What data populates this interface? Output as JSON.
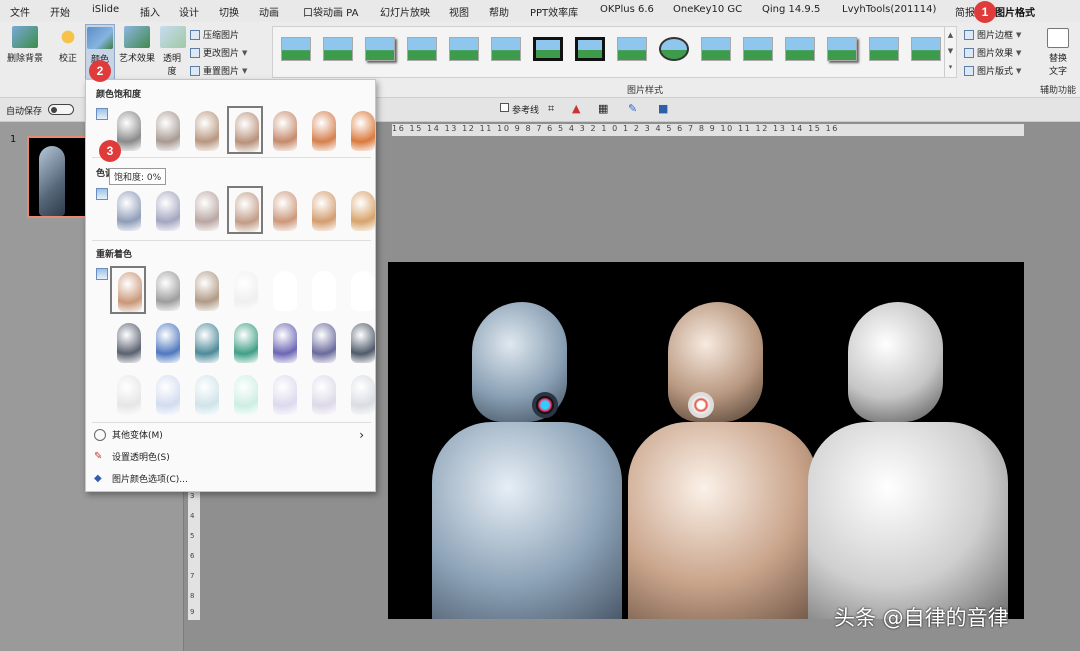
{
  "tabs": [
    "文件",
    "开始",
    "iSlide",
    "插入",
    "设计",
    "切换",
    "动画",
    "口袋动画 PA",
    "幻灯片放映",
    "视图",
    "帮助",
    "PPT效率库",
    "OKPlus 6.6",
    "OneKey10 GC",
    "Qing 14.9.5",
    "LvyhTools(201114)",
    "简报",
    "图片格式"
  ],
  "ribbon": {
    "remove_bg": "删除背景",
    "correct": "校正",
    "color": "颜色",
    "art_effects": "艺术效果",
    "transparency_l1": "透明",
    "transparency_l2": "度",
    "compress": "压缩图片",
    "change": "更改图片",
    "reset": "重置图片",
    "picture_styles_label": "图片样式",
    "border": "图片边框",
    "effects": "图片效果",
    "layout": "图片版式",
    "replace_l1": "替换",
    "replace_l2": "文字",
    "accessibility": "辅助功能"
  },
  "quickaccess": {
    "autosave": "自动保存",
    "guides": "参考线"
  },
  "ruler_h": "16 15 14 13 12 11 10 9 8 7 6 5 4 3 2 1 0 1 2 3 4 5 6 7 8 9 10 11 12 13 14 15 16",
  "ruler_v": [
    "3",
    "4",
    "5",
    "6",
    "7",
    "8",
    "9"
  ],
  "slide_number": "1",
  "dropdown": {
    "saturation_header": "颜色饱和度",
    "tone_header": "色调",
    "recolor_header": "重新着色",
    "tooltip": "饱和度: 0%",
    "more_variants": "其他变体(M)",
    "set_transparent": "设置透明色(S)",
    "color_options": "图片颜色选项(C)...",
    "arrow": "›"
  },
  "badges": [
    "1",
    "2",
    "3"
  ],
  "watermark": "头条 @自律的音律",
  "colors": {
    "accent_tab": "#b7472a",
    "badge": "#e03b3b",
    "saturation": [
      "#8a8a8a",
      "#a89a92",
      "#b8977f",
      "#b8917a",
      "#c58a6c",
      "#d4804f",
      "#db7a3d"
    ],
    "tone": [
      "#8f9db8",
      "#a3a6c0",
      "#b9a6a2",
      "#c19c86",
      "#cc987a",
      "#d39c6e",
      "#d7a36a"
    ],
    "recolor_row1": [
      "#c99778",
      "#9d9d9d",
      "#b09a86",
      "#efefef",
      "#ffffff",
      "#ffffff",
      "#ffffff"
    ],
    "recolor_row2": [
      "#5a6170",
      "#4f78c0",
      "#4e8a9a",
      "#3f9f86",
      "#6c66b5",
      "#6a6a9c",
      "#4f5a6a"
    ],
    "recolor_row3": [
      "#e6e6e6",
      "#d2dcef",
      "#cfe4ea",
      "#cdeee3",
      "#dcd9ee",
      "#ddd9e8",
      "#d9dce2"
    ]
  }
}
